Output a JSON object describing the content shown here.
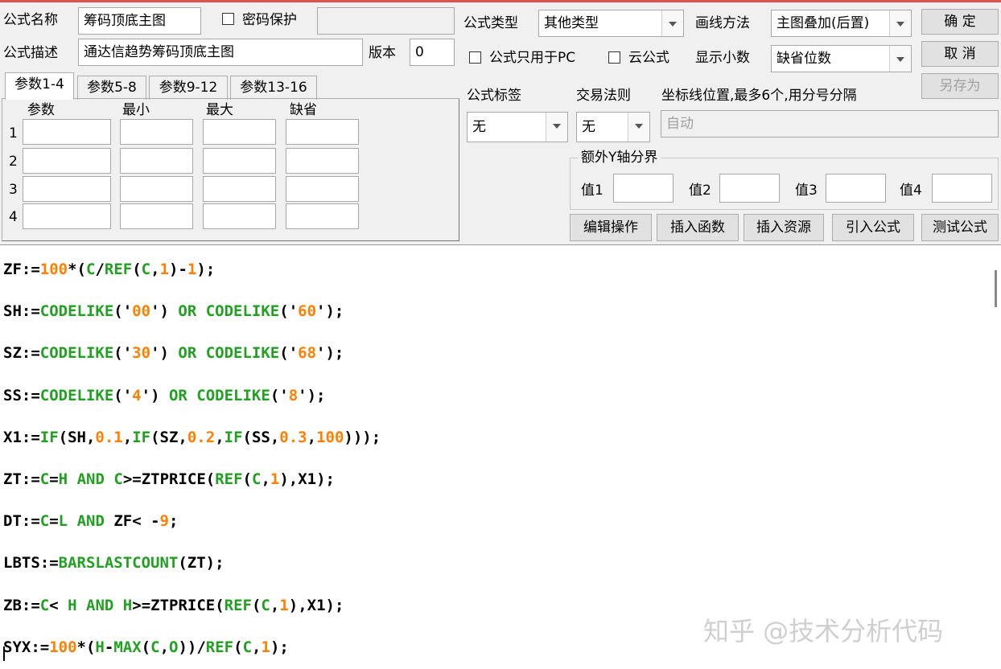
{
  "header": {
    "formula_name_label": "公式名称",
    "formula_name_value": "筹码顶底主图",
    "password_label": "密码保护",
    "password_value": "",
    "formula_desc_label": "公式描述",
    "formula_desc_value": "通达信趋势筹码顶底主图",
    "version_label": "版本",
    "version_value": "0",
    "formula_type_label": "公式类型",
    "formula_type_value": "其他类型",
    "draw_method_label": "画线方法",
    "draw_method_value": "主图叠加(后置)",
    "pc_only_label": "公式只用于PC",
    "cloud_label": "云公式",
    "decimals_label": "显示小数",
    "decimals_value": "缺省位数"
  },
  "buttons": {
    "ok": "确  定",
    "cancel": "取  消",
    "save_as": "另存为",
    "edit_ops": "编辑操作",
    "insert_func": "插入函数",
    "insert_res": "插入资源",
    "import_formula": "引入公式",
    "test_formula": "测试公式"
  },
  "tabs": [
    "参数1-4",
    "参数5-8",
    "参数9-12",
    "参数13-16"
  ],
  "params": {
    "headers": [
      "参数",
      "最小",
      "最大",
      "缺省"
    ],
    "rows": [
      "1",
      "2",
      "3",
      "4"
    ]
  },
  "options": {
    "tag_label": "公式标签",
    "tag_value": "无",
    "rule_label": "交易法则",
    "rule_value": "无",
    "axis_label": "坐标线位置,最多6个,用分号分隔",
    "axis_value": "自动",
    "y_group_title": "额外Y轴分界",
    "v1": "值1",
    "v2": "值2",
    "v3": "值3",
    "v4": "值4"
  },
  "code_lines": [
    [
      [
        "ZF:=",
        "b"
      ],
      [
        "100",
        "n"
      ],
      [
        "*(",
        "b"
      ],
      [
        "C",
        "f"
      ],
      [
        "/",
        "b"
      ],
      [
        "REF",
        "f"
      ],
      [
        "(",
        "b"
      ],
      [
        "C",
        "f"
      ],
      [
        ",",
        "b"
      ],
      [
        "1",
        "n"
      ],
      [
        ")-",
        "b"
      ],
      [
        "1",
        "n"
      ],
      [
        ");",
        "b"
      ]
    ],
    [
      [
        "SH:=",
        "b"
      ],
      [
        "CODELIKE",
        "f"
      ],
      [
        "('",
        "b"
      ],
      [
        "00",
        "n"
      ],
      [
        "') ",
        "b"
      ],
      [
        "OR",
        "f"
      ],
      [
        " ",
        "b"
      ],
      [
        "CODELIKE",
        "f"
      ],
      [
        "('",
        "b"
      ],
      [
        "60",
        "n"
      ],
      [
        "');",
        "b"
      ]
    ],
    [
      [
        "SZ:=",
        "b"
      ],
      [
        "CODELIKE",
        "f"
      ],
      [
        "('",
        "b"
      ],
      [
        "30",
        "n"
      ],
      [
        "') ",
        "b"
      ],
      [
        "OR",
        "f"
      ],
      [
        " ",
        "b"
      ],
      [
        "CODELIKE",
        "f"
      ],
      [
        "('",
        "b"
      ],
      [
        "68",
        "n"
      ],
      [
        "');",
        "b"
      ]
    ],
    [
      [
        "SS:=",
        "b"
      ],
      [
        "CODELIKE",
        "f"
      ],
      [
        "('",
        "b"
      ],
      [
        "4",
        "n"
      ],
      [
        "') ",
        "b"
      ],
      [
        "OR",
        "f"
      ],
      [
        " ",
        "b"
      ],
      [
        "CODELIKE",
        "f"
      ],
      [
        "('",
        "b"
      ],
      [
        "8",
        "n"
      ],
      [
        "');",
        "b"
      ]
    ],
    [
      [
        "X1:=",
        "b"
      ],
      [
        "IF",
        "f"
      ],
      [
        "(SH,",
        "b"
      ],
      [
        "0.1",
        "n"
      ],
      [
        ",",
        "b"
      ],
      [
        "IF",
        "f"
      ],
      [
        "(SZ,",
        "b"
      ],
      [
        "0.2",
        "n"
      ],
      [
        ",",
        "b"
      ],
      [
        "IF",
        "f"
      ],
      [
        "(SS,",
        "b"
      ],
      [
        "0.3",
        "n"
      ],
      [
        ",",
        "b"
      ],
      [
        "100",
        "n"
      ],
      [
        ")));",
        "b"
      ]
    ],
    [
      [
        "ZT:=",
        "b"
      ],
      [
        "C",
        "f"
      ],
      [
        "=",
        "b"
      ],
      [
        "H",
        "f"
      ],
      [
        " ",
        "b"
      ],
      [
        "AND",
        "f"
      ],
      [
        " ",
        "b"
      ],
      [
        "C",
        "f"
      ],
      [
        ">=ZTPRICE(",
        "b"
      ],
      [
        "REF",
        "f"
      ],
      [
        "(",
        "b"
      ],
      [
        "C",
        "f"
      ],
      [
        ",",
        "b"
      ],
      [
        "1",
        "n"
      ],
      [
        "),X1);",
        "b"
      ]
    ],
    [
      [
        "DT:=",
        "b"
      ],
      [
        "C",
        "f"
      ],
      [
        "=",
        "b"
      ],
      [
        "L",
        "f"
      ],
      [
        " ",
        "b"
      ],
      [
        "AND",
        "f"
      ],
      [
        " ZF< -",
        "b"
      ],
      [
        "9",
        "n"
      ],
      [
        ";",
        "b"
      ]
    ],
    [
      [
        "LBTS:=",
        "b"
      ],
      [
        "BARSLASTCOUNT",
        "f"
      ],
      [
        "(ZT);",
        "b"
      ]
    ],
    [
      [
        "ZB:=",
        "b"
      ],
      [
        "C",
        "f"
      ],
      [
        "< ",
        "b"
      ],
      [
        "H",
        "f"
      ],
      [
        " ",
        "b"
      ],
      [
        "AND",
        "f"
      ],
      [
        " ",
        "b"
      ],
      [
        "H",
        "f"
      ],
      [
        ">=ZTPRICE(",
        "b"
      ],
      [
        "REF",
        "f"
      ],
      [
        "(",
        "b"
      ],
      [
        "C",
        "f"
      ],
      [
        ",",
        "b"
      ],
      [
        "1",
        "n"
      ],
      [
        "),X1);",
        "b"
      ]
    ],
    [
      [
        "SYX:=",
        "b"
      ],
      [
        "100",
        "n"
      ],
      [
        "*(",
        "b"
      ],
      [
        "H",
        "f"
      ],
      [
        "-",
        "b"
      ],
      [
        "MAX",
        "f"
      ],
      [
        "(",
        "b"
      ],
      [
        "C",
        "f"
      ],
      [
        ",",
        "b"
      ],
      [
        "O",
        "f"
      ],
      [
        "))/",
        "b"
      ],
      [
        "REF",
        "f"
      ],
      [
        "(",
        "b"
      ],
      [
        "C",
        "f"
      ],
      [
        ",",
        "b"
      ],
      [
        "1",
        "n"
      ],
      [
        ");",
        "b"
      ]
    ]
  ],
  "watermark": "知乎 @技术分析代码"
}
